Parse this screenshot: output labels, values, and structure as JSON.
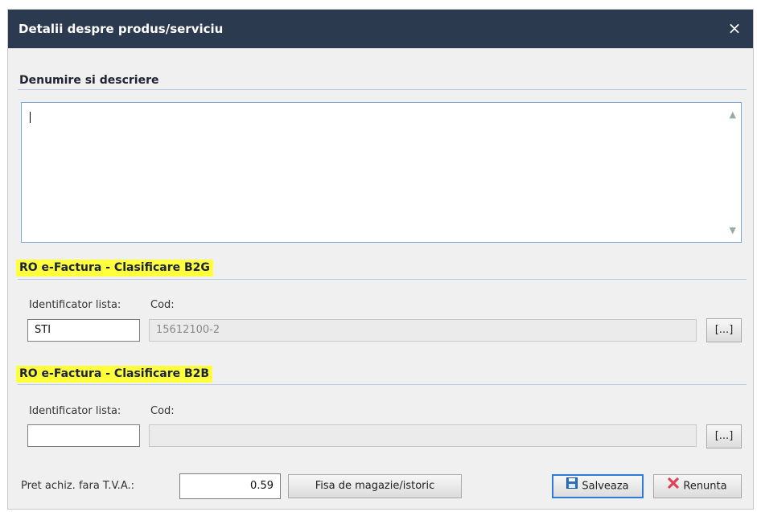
{
  "dialog": {
    "title": "Detalii despre produs/serviciu",
    "close_label": "×"
  },
  "description": {
    "heading": "Denumire si descriere",
    "value": ""
  },
  "b2g": {
    "heading": "RO e-Factura - Clasificare B2G",
    "list_id_label": "Identificator lista:",
    "list_id_value": "STI",
    "code_label": "Cod:",
    "code_value": "15612100-2",
    "browse_label": "[...]"
  },
  "b2b": {
    "heading": "RO e-Factura - Clasificare B2B",
    "list_id_label": "Identificator lista:",
    "list_id_value": "",
    "code_label": "Cod:",
    "code_value": "",
    "browse_label": "[...]"
  },
  "footer": {
    "price_label": "Pret achiz. fara T.V.A.:",
    "price_value": "0.59",
    "stock_button": "Fisa de magazie/istoric",
    "save_button": "Salveaza",
    "cancel_button": "Renunta"
  },
  "colors": {
    "titlebar": "#2b3a4f",
    "highlight": "#ffff3c",
    "accent": "#2c7bd6",
    "cancel_icon": "#e0405a"
  },
  "icons": [
    "close-icon",
    "save-icon",
    "cancel-icon",
    "scroll-up-icon",
    "scroll-down-icon"
  ]
}
